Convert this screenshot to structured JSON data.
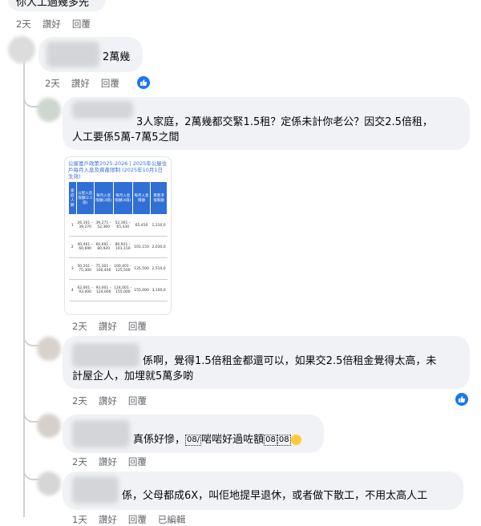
{
  "top_comment": {
    "text": "你人工過幾多先",
    "time": "2天",
    "like": "讚好",
    "reply": "回覆"
  },
  "c1": {
    "text": "2萬幾",
    "time": "2天",
    "like": "讚好",
    "reply": "回覆"
  },
  "c2": {
    "line1": "3人家庭，2萬幾都交緊1.5租？定係未計你老公？因交2.5倍租，",
    "line2": "人工要係5萬-7萬5之間",
    "time": "2天",
    "like": "讚好",
    "reply": "回覆",
    "image": {
      "title": "公屋富戶政策2025-2026 | 2025年公屋住戶每月入息及資產限制 (2025年10月1日生效)",
      "headers": [
        "家庭人數",
        "公屋入息限額(2.5倍)",
        "每月入息限額(3倍)",
        "每月入息限額(4倍)",
        "每月入息限額",
        "資產淨值限額"
      ],
      "rows": [
        [
          "1",
          "26,161 – 39,270",
          "39,271 – 52,360",
          "52,361 – 65,430",
          "65,450",
          "1,310,0"
        ],
        [
          "2",
          "40,461 – 60,690",
          "60,691 – 80,920",
          "80,921 – 101,150",
          "101,150",
          "2,030,0"
        ],
        [
          "3",
          "50,201 – 75,300",
          "75,301 – 100,400",
          "100,401 – 125,500",
          "125,500",
          "2,510,0"
        ],
        [
          "4",
          "62,001 – 93,000",
          "93,001 – 124,000",
          "124,001 – 155,000",
          "155,000",
          "3,100,0"
        ]
      ]
    }
  },
  "c3": {
    "line1": "係啊，覺得1.5倍租金都還可以，如果交2.5倍租金覺得太高，未",
    "line2": "計屋企人，加埋就5萬多啲",
    "time": "2天",
    "like": "讚好",
    "reply": "回覆"
  },
  "c4": {
    "text": "真係好慘，",
    "text2": "啱啱好過咗額",
    "box1": "08/",
    "box2": "08",
    "box3": "08",
    "time": "2天",
    "like": "讚好",
    "reply": "回覆"
  },
  "c5": {
    "text": "係，父母都成6X，叫佢地提早退休，或者做下散工，不用太高人工",
    "time": "1天",
    "like": "讚好",
    "reply": "回覆",
    "edited": "已編輯"
  },
  "colors": {
    "bubble": "#f0f2f5",
    "accent": "#1877f2",
    "meta": "#65676b"
  }
}
